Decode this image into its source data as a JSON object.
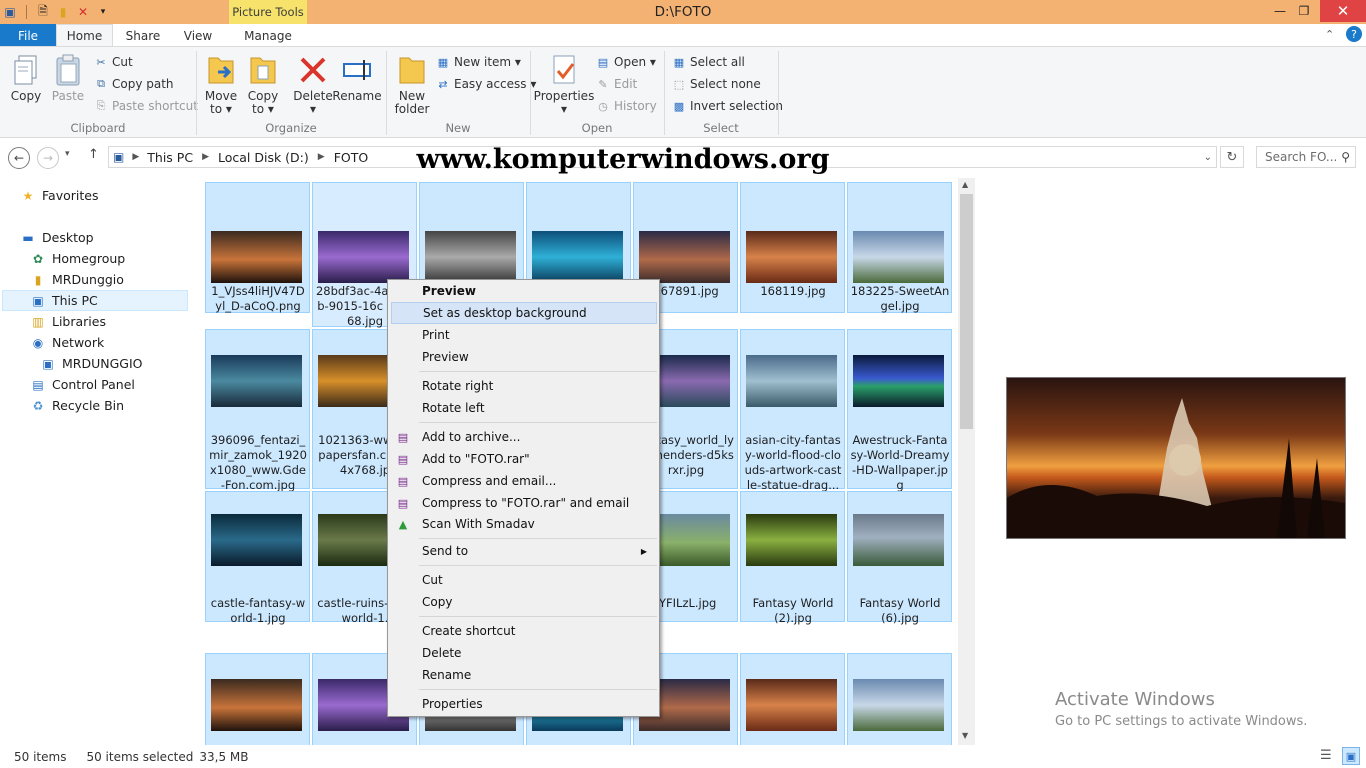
{
  "window": {
    "title": "D:\\FOTO",
    "contextual_tab": "Picture Tools",
    "colors": {
      "titlebar": "#f3b272",
      "contextual": "#f7e36b",
      "file_tab": "#1979ca",
      "selection": "#cce8ff",
      "close": "#e04343"
    }
  },
  "tabs": {
    "file": "File",
    "home": "Home",
    "share": "Share",
    "view": "View",
    "manage": "Manage"
  },
  "ribbon": {
    "clipboard": {
      "copy": "Copy",
      "paste": "Paste",
      "cut": "Cut",
      "copy_path": "Copy path",
      "paste_shortcut": "Paste shortcut",
      "label": "Clipboard"
    },
    "organize": {
      "move_to": "Move",
      "move_to2": "to ▾",
      "copy_to": "Copy",
      "copy_to2": "to ▾",
      "delete": "Delete",
      "delete2": "▾",
      "rename": "Rename",
      "label": "Organize"
    },
    "new": {
      "new_folder": "New",
      "new_folder2": "folder",
      "new_item": "New item ▾",
      "easy_access": "Easy access ▾",
      "label": "New"
    },
    "open": {
      "properties": "Properties",
      "properties2": "▾",
      "open": "Open ▾",
      "edit": "Edit",
      "history": "History",
      "label": "Open"
    },
    "select": {
      "select_all": "Select all",
      "select_none": "Select none",
      "invert": "Invert selection",
      "label": "Select"
    }
  },
  "address": {
    "crumbs": [
      "This PC",
      "Local Disk (D:)",
      "FOTO"
    ],
    "search_placeholder": "Search FO..."
  },
  "watermark": "www.komputerwindows.org",
  "nav": {
    "favorites": "Favorites",
    "desktop": "Desktop",
    "homegroup": "Homegroup",
    "mrdunggio": "MRDunggio",
    "this_pc": "This PC",
    "libraries": "Libraries",
    "network": "Network",
    "mrdunggio_pc": "MRDUNGGIO",
    "control_panel": "Control Panel",
    "recycle_bin": "Recycle Bin"
  },
  "files": [
    {
      "name": "1_VJss4liHJV47Dyl_D-aCoQ.png"
    },
    {
      "name": "28bdf3ac-4a5 61b-9015-16c 6f5468.jpg"
    },
    {
      "name": ""
    },
    {
      "name": ""
    },
    {
      "name": "167891.jpg"
    },
    {
      "name": "168119.jpg"
    },
    {
      "name": "183225-SweetAngel.jpg"
    },
    {
      "name": "396096_fentazi_mir_zamok_1920x1080_www.Gde-Fon.com.jpg"
    },
    {
      "name": "1021363-www llpapersfan.c 1024x768.jp"
    },
    {
      "name": ""
    },
    {
      "name": ""
    },
    {
      "name": "fantasy_world_lydalhenders-d5ksrxr.jpg"
    },
    {
      "name": "asian-city-fantasy-world-flood-clouds-artwork-castle-statue-drag..."
    },
    {
      "name": "Awestruck-Fantasy-World-Dreamy-HD-Wallpaper.jpg"
    },
    {
      "name": "castle-fantasy-world-1.jpg"
    },
    {
      "name": "castle-ruins-f sy-world-1."
    },
    {
      "name": ""
    },
    {
      "name": ""
    },
    {
      "name": "IYFILzL.jpg"
    },
    {
      "name": "Fantasy World (2).jpg"
    },
    {
      "name": "Fantasy World (6).jpg"
    },
    {
      "name": ""
    },
    {
      "name": ""
    },
    {
      "name": ""
    },
    {
      "name": ""
    },
    {
      "name": ""
    },
    {
      "name": ""
    },
    {
      "name": ""
    }
  ],
  "context_menu": {
    "preview_bold": "Preview",
    "set_bg": "Set as desktop background",
    "print": "Print",
    "preview": "Preview",
    "rotate_right": "Rotate right",
    "rotate_left": "Rotate left",
    "add_archive": "Add to archive...",
    "add_rar": "Add to \"FOTO.rar\"",
    "compress_email": "Compress and email...",
    "compress_rar_email": "Compress to \"FOTO.rar\" and email",
    "scan": "Scan With Smadav",
    "send_to": "Send to",
    "cut": "Cut",
    "copy": "Copy",
    "create_shortcut": "Create shortcut",
    "delete": "Delete",
    "rename": "Rename",
    "properties": "Properties"
  },
  "activate": {
    "title": "Activate Windows",
    "subtitle": "Go to PC settings to activate Windows."
  },
  "status": {
    "count": "50 items",
    "selected": "50 items selected",
    "size": "33,5 MB"
  }
}
